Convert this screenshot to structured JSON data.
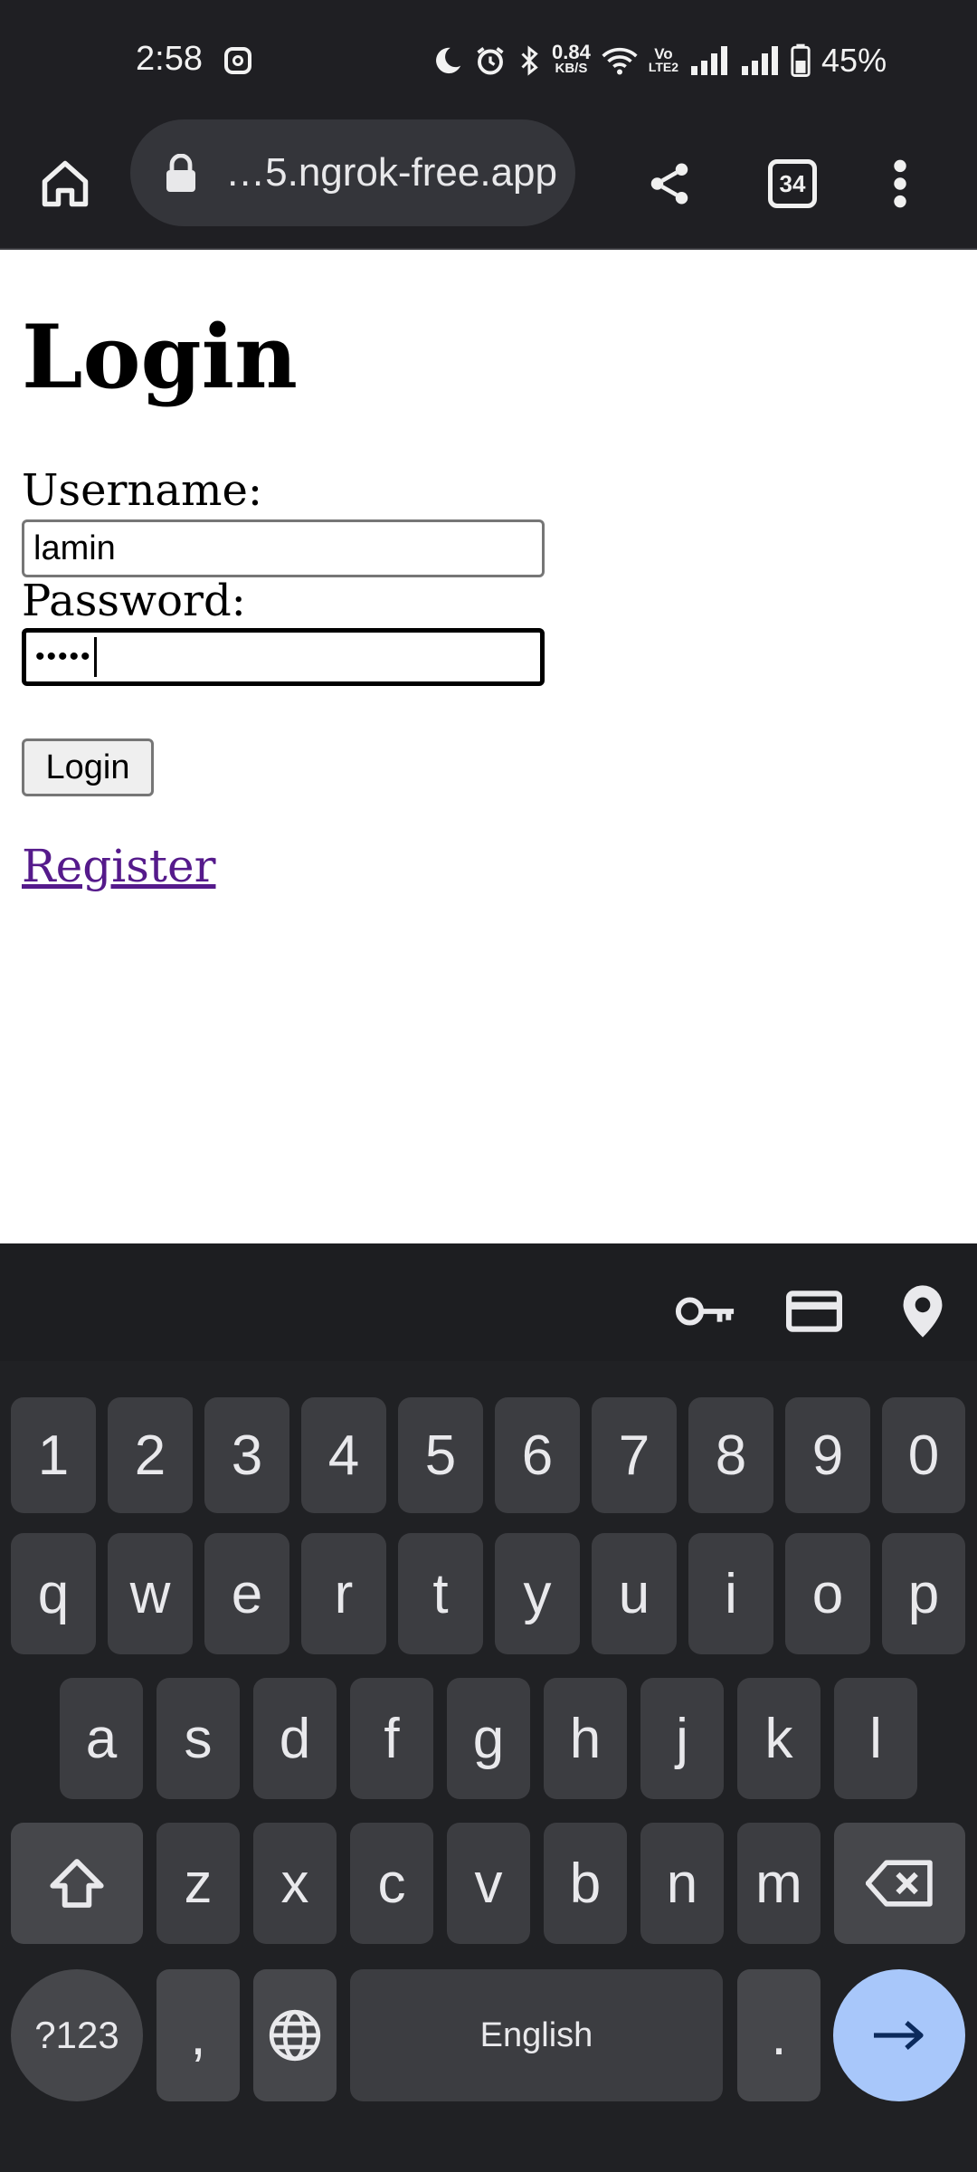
{
  "status_bar": {
    "time": "2:58",
    "net_speed_value": "0.84",
    "net_speed_unit": "KB/S",
    "volte_top": "Vo",
    "volte_bottom": "LTE2",
    "battery_percent": "45%"
  },
  "browser": {
    "url": "…5.ngrok-free.app",
    "tab_count": "34"
  },
  "page": {
    "title": "Login",
    "username_label": "Username:",
    "username_value": "lamin",
    "password_label": "Password:",
    "password_value": "•••••",
    "login_button": "Login",
    "register_link": "Register"
  },
  "keyboard": {
    "row_numbers": [
      "1",
      "2",
      "3",
      "4",
      "5",
      "6",
      "7",
      "8",
      "9",
      "0"
    ],
    "row_top": [
      "q",
      "w",
      "e",
      "r",
      "t",
      "y",
      "u",
      "i",
      "o",
      "p"
    ],
    "row_middle": [
      "a",
      "s",
      "d",
      "f",
      "g",
      "h",
      "j",
      "k",
      "l"
    ],
    "row_bottom": [
      "z",
      "x",
      "c",
      "v",
      "b",
      "n",
      "m"
    ],
    "symbols_key": "?123",
    "comma_key": ",",
    "space_key": "English",
    "period_key": ".",
    "accent_color": "#a8c7fa"
  },
  "colors": {
    "chrome_bg": "#1f1f23",
    "link_visited": "#551a8b"
  }
}
